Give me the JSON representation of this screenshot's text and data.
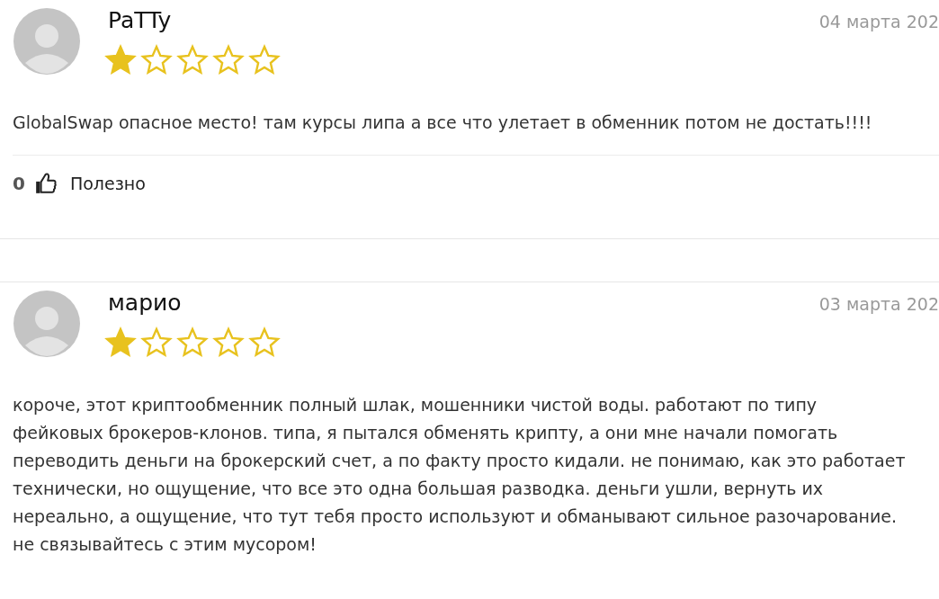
{
  "reviews": [
    {
      "author": "PaTTy",
      "date": "04 марта 202",
      "stars": 1,
      "text": "GlobalSwap опасное место! там курсы липа а все что улетает в обменник потом не достать!!!!",
      "helpful_count": "0",
      "helpful_label": "Полезно"
    },
    {
      "author": "марио",
      "date": "03 марта 202",
      "stars": 1,
      "text": "короче, этот криптообменник полный шлак, мошенники чистой воды. работают по типу фейковых брокеров-клонов. типа, я пытался обменять крипту, а они мне начали помогать переводить деньги на брокерский счет, а по факту просто кидали. не понимаю, как это работает технически, но ощущение, что все это одна большая разводка. деньги ушли, вернуть их нереально, а ощущение, что тут тебя просто используют и обманывают сильное разочарование. не связывайтесь с этим мусором!"
    }
  ]
}
